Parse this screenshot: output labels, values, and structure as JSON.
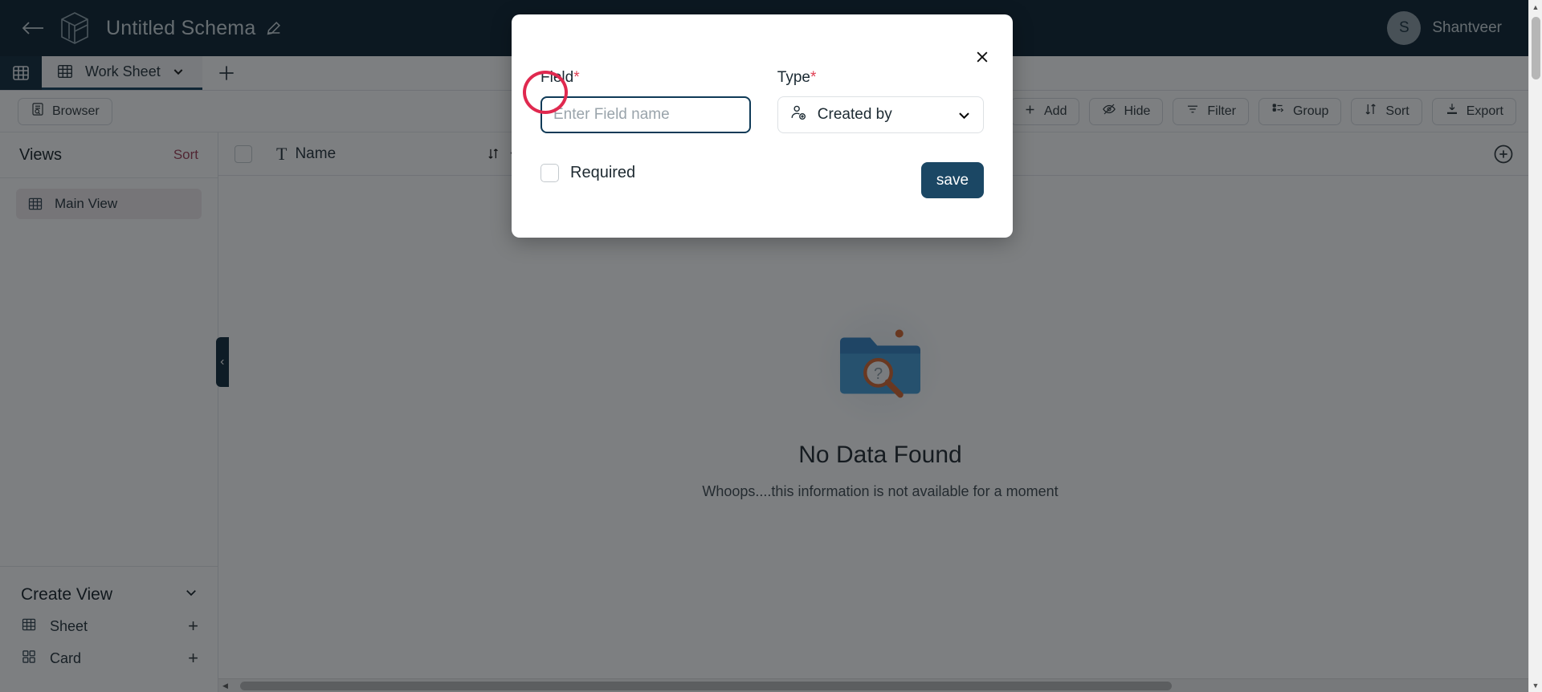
{
  "header": {
    "back_icon": "arrow-left-icon",
    "logo_icon": "cube-logo-icon",
    "title": "Untitled Schema",
    "edit_icon": "pencil-icon",
    "user": {
      "initial": "S",
      "name": "Shantveer"
    }
  },
  "tabs": {
    "table_icon": "table-icon",
    "items": [
      {
        "label": "Work Sheet",
        "icon": "grid-icon",
        "active": true
      }
    ],
    "add_label": "+"
  },
  "toolbar": {
    "browser_label": "Browser",
    "browser_icon": "browser-icon",
    "buttons": [
      {
        "label": "Add",
        "icon": "plus-icon"
      },
      {
        "label": "Hide",
        "icon": "eye-off-icon"
      },
      {
        "label": "Filter",
        "icon": "filter-icon"
      },
      {
        "label": "Group",
        "icon": "group-icon"
      },
      {
        "label": "Sort",
        "icon": "sort-icon"
      },
      {
        "label": "Export",
        "icon": "download-icon"
      }
    ]
  },
  "sidebar": {
    "views_title": "Views",
    "views_sort_label": "Sort",
    "views": [
      {
        "label": "Main View",
        "icon": "grid-icon",
        "active": true
      }
    ],
    "create_view": {
      "title": "Create View",
      "chevron_icon": "chevron-down-icon",
      "rows": [
        {
          "label": "Sheet",
          "icon": "grid-icon",
          "add": "+"
        },
        {
          "label": "Card",
          "icon": "card-grid-icon",
          "add": "+"
        }
      ]
    },
    "collapse_icon": "chevron-left-icon"
  },
  "grid": {
    "columns": [
      {
        "label": "Name",
        "type_icon": "text-type-icon",
        "sort_icon": "sort-icon",
        "menu_icon": "chevron-down-icon"
      }
    ],
    "add_column_icon": "plus-circle-icon",
    "empty": {
      "illustration": "folder-search-icon",
      "title": "No Data Found",
      "subtitle": "Whoops....this information is not available for a moment"
    }
  },
  "modal": {
    "close_icon": "close-icon",
    "field": {
      "label": "Field",
      "required_marker": "*",
      "placeholder": "Enter Field name",
      "value": ""
    },
    "type": {
      "label": "Type",
      "required_marker": "*",
      "selected": "Created by",
      "icon": "user-created-icon",
      "chevron_icon": "chevron-down-icon"
    },
    "required_checkbox": {
      "label": "Required",
      "checked": false
    },
    "save_label": "save"
  },
  "colors": {
    "header_bg": "#061C2B",
    "accent_navy": "#1b4764",
    "required_red": "#e03e52",
    "annotation_red": "#e0294f",
    "sidebar_active": "#f0e9ec"
  },
  "scrollbars": {
    "up": "▲",
    "down": "▼",
    "left": "◀",
    "right": "▶"
  }
}
